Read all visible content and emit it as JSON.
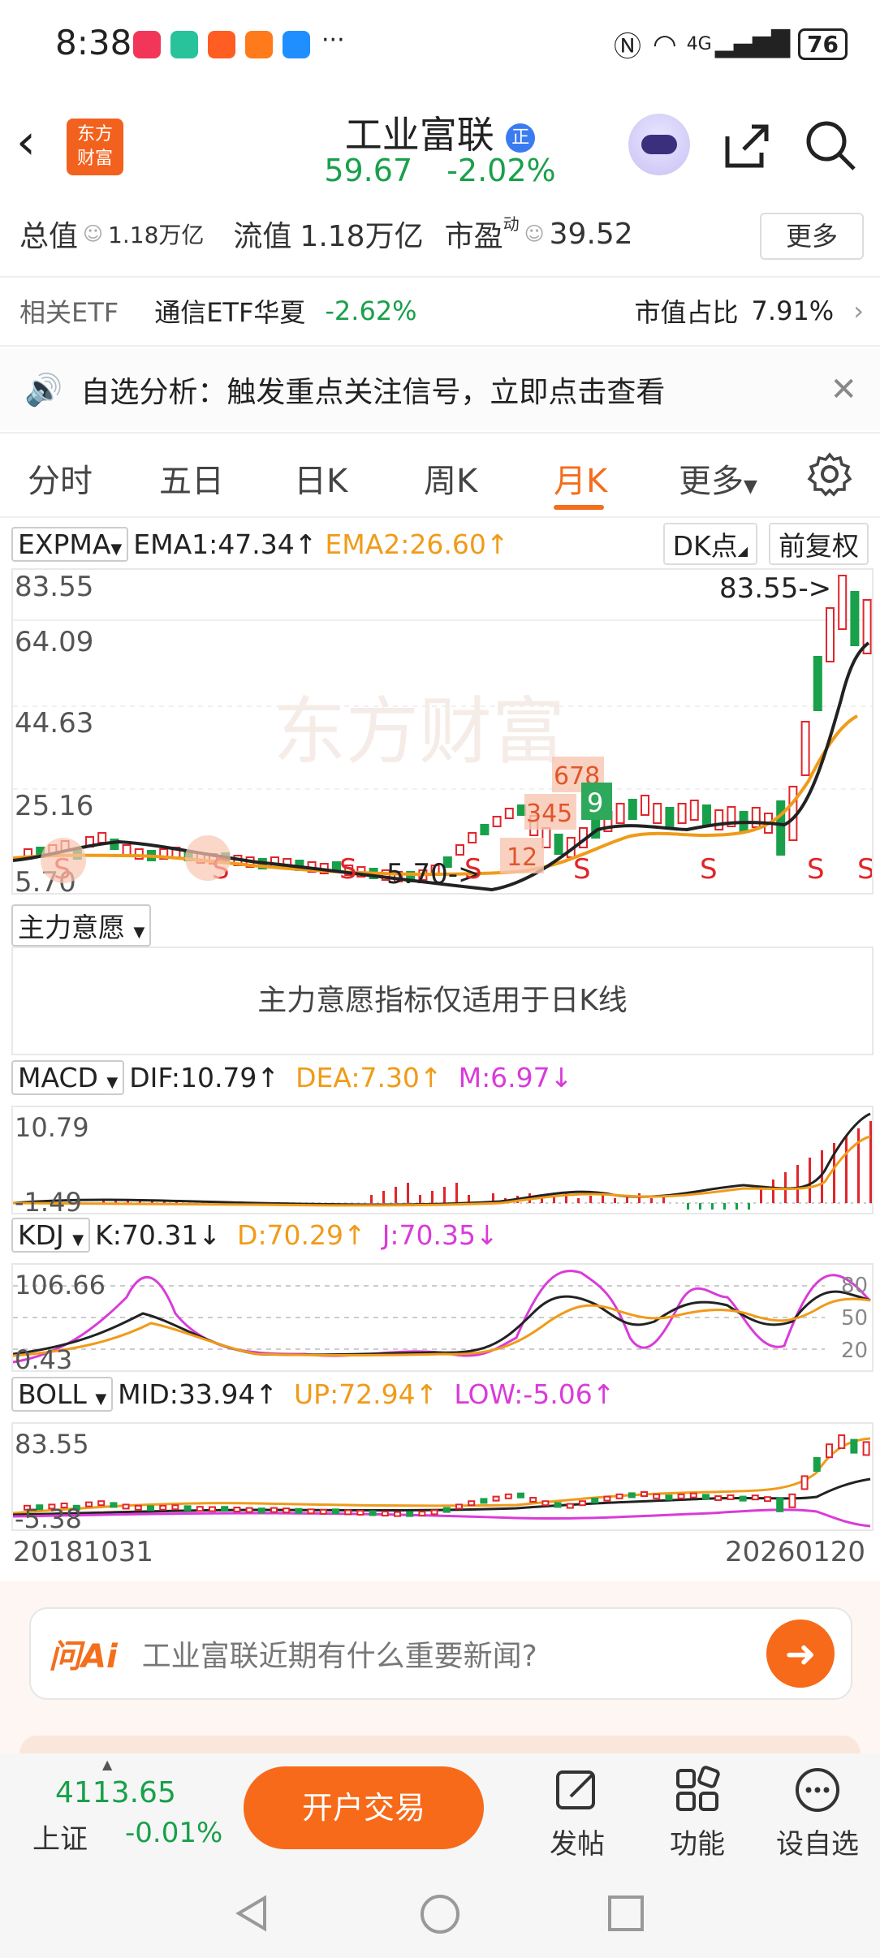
{
  "status_bar": {
    "time": "8:38",
    "more_indicator": "···",
    "signal_text": "4G",
    "battery": "76"
  },
  "header": {
    "logo_line1": "东方",
    "logo_line2": "财富",
    "title": "工业富联",
    "badge": "正",
    "price": "59.67",
    "change_pct": "-2.02%"
  },
  "info": {
    "total_value_label": "总值",
    "total_value": "1.18万亿",
    "float_value_label": "流值",
    "float_value": "1.18万亿",
    "pe_label": "市盈",
    "pe_super": "动",
    "pe_value": "39.52",
    "more_button": "更多"
  },
  "etf": {
    "label": "相关ETF",
    "name": "通信ETF华夏",
    "change": "-2.62%",
    "weight_label": "市值占比",
    "weight": "7.91%"
  },
  "banner": {
    "text": "自选分析：触发重点关注信号，立即点击查看"
  },
  "tabs": [
    "分时",
    "五日",
    "日K",
    "周K",
    "月K",
    "更多"
  ],
  "active_tab": "月K",
  "main_chart": {
    "indicator": "EXPMA",
    "ema1": "EMA1:47.34↑",
    "ema2": "EMA2:26.60↑",
    "dk_button": "DK点",
    "adjust_button": "前复权",
    "y_labels": [
      "83.55",
      "64.09",
      "44.63",
      "25.16",
      "5.70"
    ],
    "max_annotation": "83.55->",
    "min_annotation": "5.70->",
    "watermark": "东方财富",
    "seq_labels": [
      "12",
      "345",
      "678",
      "9"
    ],
    "signal_label": "S"
  },
  "zhuli": {
    "label": "主力意愿",
    "message": "主力意愿指标仅适用于日K线"
  },
  "macd": {
    "label": "MACD",
    "dif": "DIF:10.79↑",
    "dea": "DEA:7.30↑",
    "m": "M:6.97↓",
    "y_top": "10.79",
    "y_bottom": "-1.49"
  },
  "kdj": {
    "label": "KDJ",
    "k": "K:70.31↓",
    "d": "D:70.29↑",
    "j": "J:70.35↓",
    "y_top": "106.66",
    "y_bottom": "0.43",
    "levels": [
      "80",
      "50",
      "20"
    ]
  },
  "boll": {
    "label": "BOLL",
    "mid": "MID:33.94↑",
    "up": "UP:72.94↑",
    "low": "LOW:-5.06↑",
    "y_top": "83.55",
    "y_bottom": "-5.38"
  },
  "dates": {
    "start": "20181031",
    "end": "20260120"
  },
  "ask": {
    "brand": "问Ai",
    "prompt": "工业富联近期有什么重要新闻?"
  },
  "bottom": {
    "index_value": "4113.65",
    "index_name": "上证",
    "index_change": "-0.01%",
    "open_button": "开户交易",
    "post": "发帖",
    "functions": "功能",
    "add_watch": "设自选"
  },
  "colors": {
    "accent": "#f36e1d",
    "up_red": "#e0262b",
    "down_green": "#19a04a",
    "ema_orange": "#f09b19",
    "magenta": "#d93bd9"
  }
}
